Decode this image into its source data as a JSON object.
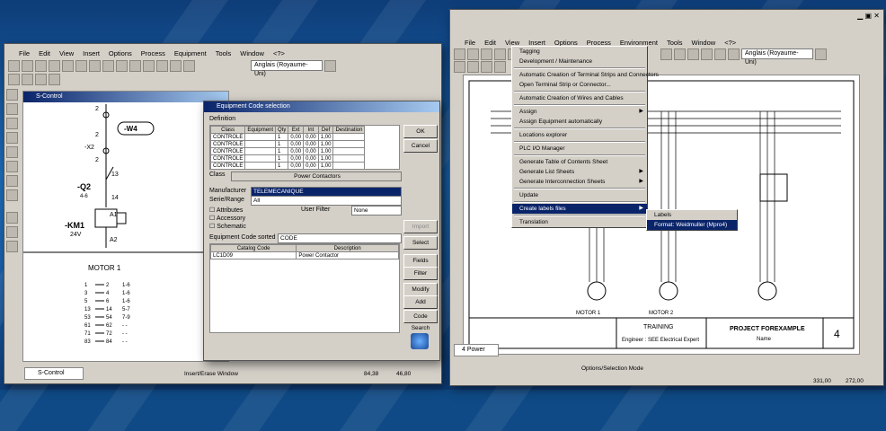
{
  "left_window": {
    "menu": [
      "File",
      "Edit",
      "View",
      "Insert",
      "Options",
      "Process",
      "Equipment",
      "Tools",
      "Window",
      "<?>"
    ],
    "language": "Anglais (Royaume-Uni)",
    "doc_title": "S-Control",
    "schematic": {
      "labels": [
        "2",
        "-W4",
        "2",
        "-X2",
        "2",
        "13",
        "-Q2",
        "4-6",
        "14",
        "A1",
        "-KM1",
        "24V",
        "A2",
        "MOTOR 1"
      ],
      "contacts": [
        {
          "a": "1",
          "b": "2",
          "c": "1-6"
        },
        {
          "a": "3",
          "b": "4",
          "c": "1-6"
        },
        {
          "a": "5",
          "b": "6",
          "c": "1-6"
        },
        {
          "a": "13",
          "b": "14",
          "c": "5-7"
        },
        {
          "a": "53",
          "b": "54",
          "c": "7-9"
        },
        {
          "a": "61",
          "b": "62",
          "c": "- -"
        },
        {
          "a": "71",
          "b": "72",
          "c": "- -"
        },
        {
          "a": "83",
          "b": "84",
          "c": "- -"
        }
      ]
    },
    "tab": "S-Control",
    "status": "Insert/Erase Window",
    "coords": [
      "84,38",
      "46,80"
    ]
  },
  "dialog": {
    "title": "Equipment Code selection",
    "definition_label": "Definition",
    "def_headers": [
      "Class",
      "Equipment",
      "Qty",
      "Ext",
      "Int",
      "Def",
      "Destination"
    ],
    "def_rows": [
      [
        "CONTROLE",
        "",
        "1",
        "0,00",
        "0,00",
        "1,00",
        ""
      ],
      [
        "CONTROLE",
        "",
        "1",
        "0,00",
        "0,00",
        "1,00",
        ""
      ],
      [
        "CONTROLE",
        "",
        "1",
        "0,00",
        "0,00",
        "1,00",
        ""
      ],
      [
        "CONTROLE",
        "",
        "1",
        "0,00",
        "0,00",
        "1,00",
        ""
      ],
      [
        "CONTROLE",
        "",
        "1",
        "0,00",
        "0,00",
        "1,00",
        ""
      ]
    ],
    "class_label": "Class",
    "class_value": "Power Contactors",
    "manufacturer_label": "Manufacturer",
    "manufacturer_value": "TELEMECANIQUE",
    "series_label": "Serie/Range",
    "series_value": "All",
    "checks": [
      "Attributes",
      "Accessory",
      "Schematic"
    ],
    "user_filter_label": "User Filter",
    "user_filter_value": "None",
    "code_sorted_label": "Equipment Code sorted by:",
    "code_sorted_value": "CODE",
    "cat_headers": [
      "Catalog Code",
      "Description"
    ],
    "cat_rows": [
      [
        "LC1D09",
        "Power Contactor"
      ]
    ],
    "buttons": [
      "OK",
      "Cancel",
      "Import",
      "Select",
      "Fields",
      "Filter",
      "Modify",
      "Add",
      "Code Search"
    ]
  },
  "right_window": {
    "menu": [
      "File",
      "Edit",
      "View",
      "Insert",
      "Options",
      "Process",
      "Environment",
      "Tools",
      "Window",
      "<?>"
    ],
    "language": "Anglais (Royaume-Uni)",
    "process_menu": [
      {
        "label": "Tagging"
      },
      {
        "label": "Development / Maintenance"
      },
      {
        "sep": true
      },
      {
        "label": "Automatic Creation of Terminal Strips and Connectors"
      },
      {
        "label": "Open Terminal Strip or Connector..."
      },
      {
        "sep": true
      },
      {
        "label": "Automatic Creation of Wires and Cables"
      },
      {
        "sep": true
      },
      {
        "label": "Assign",
        "arrow": true
      },
      {
        "label": "Assign Equipment automatically"
      },
      {
        "sep": true
      },
      {
        "label": "Locations explorer"
      },
      {
        "sep": true
      },
      {
        "label": "PLC I/O Manager"
      },
      {
        "sep": true
      },
      {
        "label": "Generate Table of Contents Sheet"
      },
      {
        "label": "Generate List Sheets",
        "arrow": true
      },
      {
        "label": "Generate Interconnection Sheets",
        "arrow": true
      },
      {
        "sep": true
      },
      {
        "label": "Update"
      },
      {
        "sep": true
      },
      {
        "label": "Create labels files",
        "arrow": true,
        "selected": true
      },
      {
        "sep": true
      },
      {
        "label": "Translation"
      }
    ],
    "submenu": [
      "Labels",
      "Format: Weidmuller (Mpro4)"
    ],
    "drawing": {
      "motor1": "MOTOR 1",
      "motor2": "MOTOR 2",
      "training": "TRAINING",
      "engineer": "Engineer : SEE Electrical Expert",
      "project": "PROJECT FOREXAMPLE",
      "project_sub": "Name",
      "sheet": "4"
    },
    "tab": "4 Power",
    "status": "Options/Selection Mode",
    "coords": [
      "331,00",
      "272,00"
    ]
  }
}
